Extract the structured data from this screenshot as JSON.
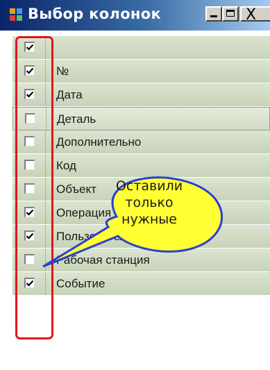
{
  "window": {
    "title": "Выбор колонок",
    "close_glyph": "X",
    "icons": {
      "app": "app-grid-icon",
      "minimize": "minimize-icon",
      "maximize": "maximize-icon",
      "close": "close-icon"
    }
  },
  "columns": [
    {
      "label": "",
      "checked": true
    },
    {
      "label": "№",
      "checked": true
    },
    {
      "label": "Дата",
      "checked": true
    },
    {
      "label": "Деталь",
      "checked": false,
      "focused": true
    },
    {
      "label": "Дополнительно",
      "checked": false
    },
    {
      "label": "Код",
      "checked": false
    },
    {
      "label": "Объект",
      "checked": false
    },
    {
      "label": "Операция",
      "checked": true
    },
    {
      "label": "Пользователь",
      "checked": true
    },
    {
      "label": "Рабочая станция",
      "checked": false
    },
    {
      "label": "Событие",
      "checked": true
    }
  ],
  "callout": {
    "lines": [
      "Оставили",
      "только",
      "нужные"
    ],
    "fill": "#ffff33",
    "stroke": "#2a3fd0"
  },
  "colors": {
    "title_bar_start": "#0a246a",
    "title_bar_end": "#a6caf0",
    "row_fill": "#d3dcc6",
    "highlight_border": "#e0141e"
  }
}
